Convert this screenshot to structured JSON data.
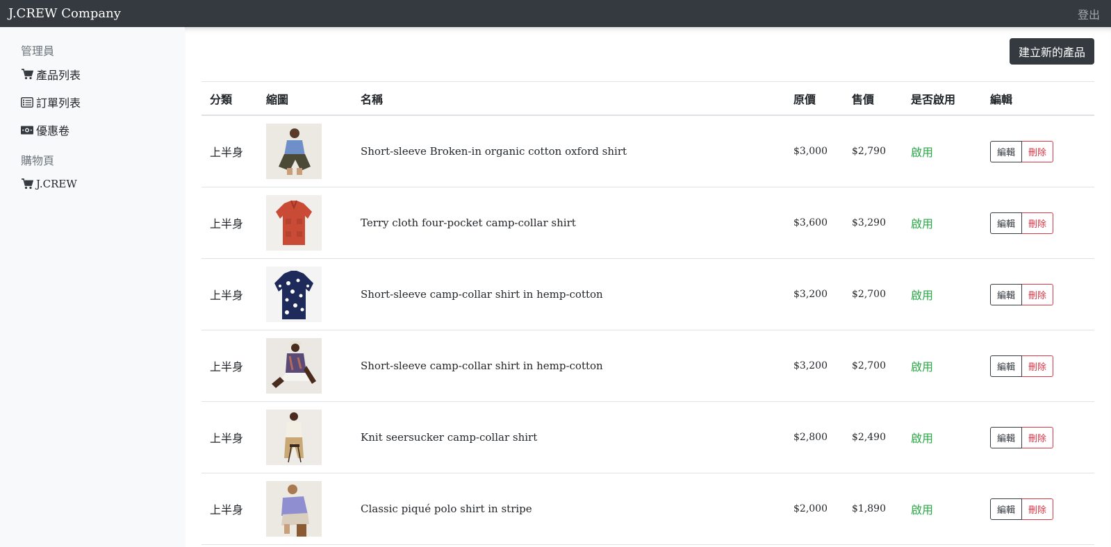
{
  "navbar": {
    "brand": "J.CREW Company",
    "logout": "登出"
  },
  "sidebar": {
    "admin_heading": "管理員",
    "admin_items": [
      {
        "icon": "cart-icon",
        "label": "產品列表"
      },
      {
        "icon": "list-icon",
        "label": "訂單列表"
      },
      {
        "icon": "money-icon",
        "label": "優惠卷"
      }
    ],
    "shop_heading": "購物頁",
    "shop_items": [
      {
        "icon": "cart-icon",
        "label": "J.CREW"
      }
    ]
  },
  "main": {
    "create_button": "建立新的產品",
    "columns": [
      "分類",
      "縮圖",
      "名稱",
      "原價",
      "售價",
      "是否啟用",
      "編輯"
    ],
    "rows": [
      {
        "category": "上半身",
        "name": "Short-sleeve Broken-in organic cotton oxford shirt",
        "original_price": "$3,000",
        "price": "$2,790",
        "enabled": "啟用",
        "edit": "編輯",
        "delete": "刪除",
        "thumb_icon": "product-thumbnail-model-blue-oxford-shirt"
      },
      {
        "category": "上半身",
        "name": "Terry cloth four-pocket camp-collar shirt",
        "original_price": "$3,600",
        "price": "$3,290",
        "enabled": "啟用",
        "edit": "編輯",
        "delete": "刪除",
        "thumb_icon": "product-thumbnail-red-terry-shirt"
      },
      {
        "category": "上半身",
        "name": "Short-sleeve camp-collar shirt in hemp-cotton",
        "original_price": "$3,200",
        "price": "$2,700",
        "enabled": "啟用",
        "edit": "編輯",
        "delete": "刪除",
        "thumb_icon": "product-thumbnail-navy-floral-shirt"
      },
      {
        "category": "上半身",
        "name": "Short-sleeve camp-collar shirt in hemp-cotton",
        "original_price": "$3,200",
        "price": "$2,700",
        "enabled": "啟用",
        "edit": "編輯",
        "delete": "刪除",
        "thumb_icon": "product-thumbnail-model-seated-shirt"
      },
      {
        "category": "上半身",
        "name": "Knit seersucker camp-collar shirt",
        "original_price": "$2,800",
        "price": "$2,490",
        "enabled": "啟用",
        "edit": "編輯",
        "delete": "刪除",
        "thumb_icon": "product-thumbnail-model-stool-shirt"
      },
      {
        "category": "上半身",
        "name": "Classic piqué polo shirt in stripe",
        "original_price": "$2,000",
        "price": "$1,890",
        "enabled": "啟用",
        "edit": "編輯",
        "delete": "刪除",
        "thumb_icon": "product-thumbnail-model-polo-shirt"
      }
    ]
  },
  "colors": {
    "navbar": "#343a40",
    "sidebar": "#f8f9fa",
    "enabled": "#28a745",
    "delete": "#dc3545"
  }
}
